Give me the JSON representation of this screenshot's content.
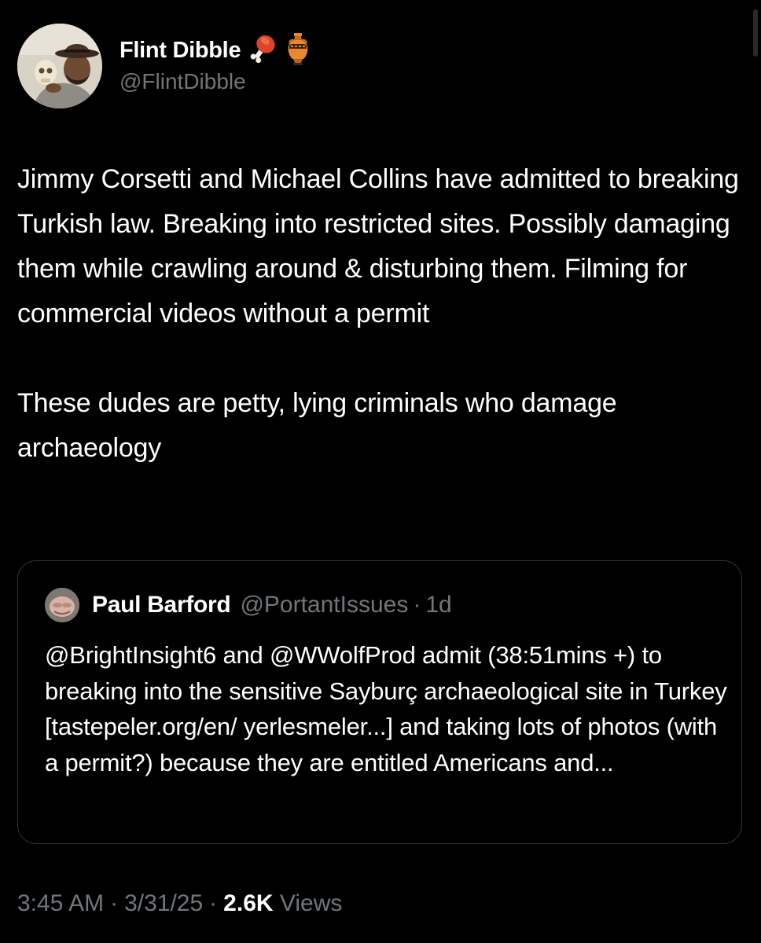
{
  "author": {
    "name": "Flint Dibble",
    "handle": "@FlintDibble",
    "name_emojis": [
      "meat-on-bone-icon",
      "amphora-icon"
    ]
  },
  "tweet": {
    "paragraphs": [
      "Jimmy Corsetti and Michael Collins have admitted to breaking Turkish law. Breaking into restricted sites. Possibly damaging them while crawling around & disturbing them. Filming for commercial videos without a permit",
      "These dudes are petty, lying criminals who damage archaeology"
    ]
  },
  "quote": {
    "name": "Paul Barford",
    "handle": "@PortantIssues",
    "separator": "·",
    "time": "1d",
    "text": "@BrightInsight6 and @WWolfProd admit (38:51mins +) to breaking into the sensitive Sayburç archaeological site in Turkey [tastepeler.org/en/ yerlesmeler...] and taking lots of photos (with a permit?) because they are entitled Americans and..."
  },
  "meta": {
    "time": "3:45 AM",
    "date": "3/31/25",
    "separator": "·",
    "views_count": "2.6K",
    "views_label": "Views"
  },
  "colors": {
    "background": "#000000",
    "text": "#ffffff",
    "secondary": "#71767b",
    "border": "#2f3336"
  }
}
